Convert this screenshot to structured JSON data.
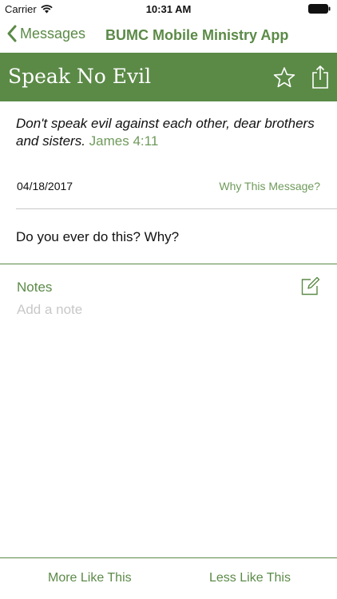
{
  "status_bar": {
    "carrier": "Carrier",
    "time": "10:31 AM"
  },
  "nav": {
    "back_label": "Messages",
    "title": "BUMC Mobile Ministry App"
  },
  "header": {
    "title": "Speak No Evil"
  },
  "verse": {
    "text": "Don't speak evil against each other, dear brothers and sisters.",
    "reference": "James 4:11"
  },
  "meta": {
    "date": "04/18/2017",
    "why_link": "Why This Message?"
  },
  "question": "Do you ever do this? Why?",
  "notes": {
    "label": "Notes",
    "placeholder": "Add a note"
  },
  "bottom": {
    "more_label": "More Like This",
    "less_label": "Less Like This"
  },
  "colors": {
    "accent": "#5b8a47",
    "accent_light": "#6f9a5b",
    "placeholder": "#c8c8c8"
  }
}
